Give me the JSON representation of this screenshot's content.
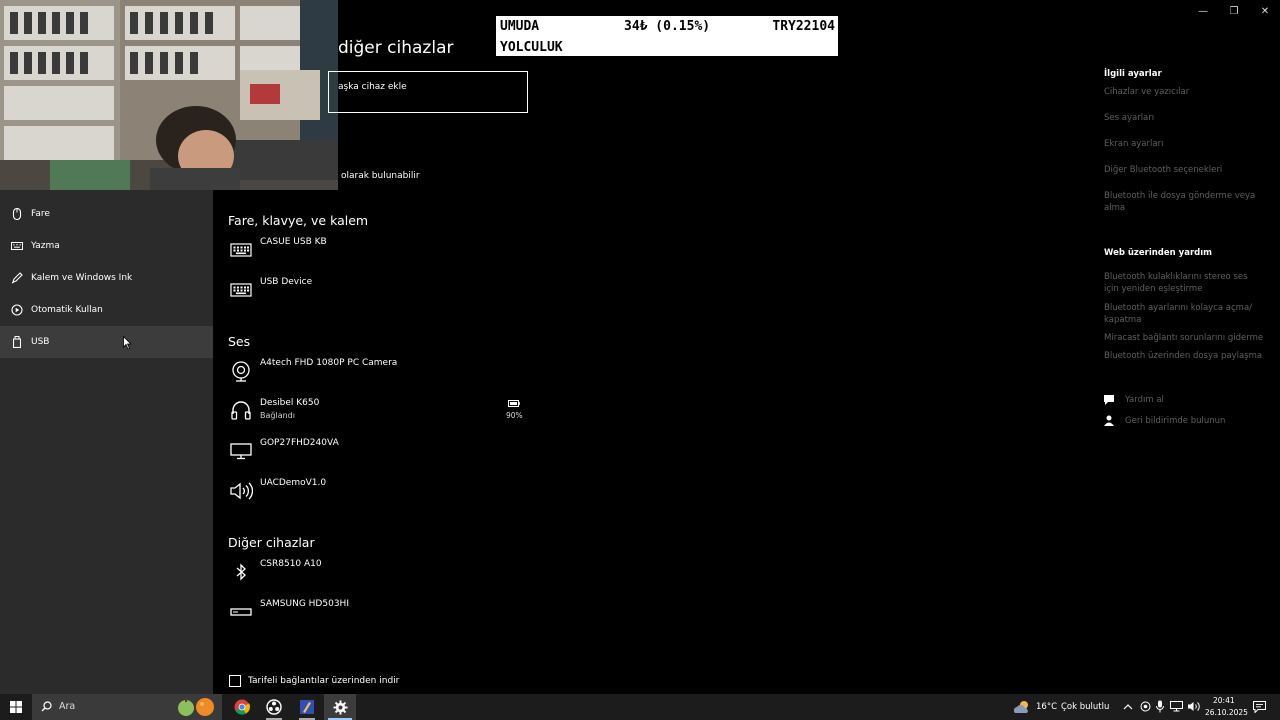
{
  "window": {
    "title_partial": "diğer cihazlar",
    "add_device_partial": "aşka cihaz ekle",
    "discoverable_partial": "olarak bulunabilir"
  },
  "window_controls": {
    "minimize": "—",
    "maximize": "❐",
    "close": "✕"
  },
  "ticker": {
    "name_line1": "UMUDA",
    "name_line2": "YOLCULUK",
    "change": "34₺ (0.15%)",
    "value": "TRY22104"
  },
  "nav": {
    "items": [
      {
        "label": "Fare",
        "icon": "mouse-icon"
      },
      {
        "label": "Yazma",
        "icon": "keyboard-icon"
      },
      {
        "label": "Kalem ve Windows Ink",
        "icon": "pen-icon"
      },
      {
        "label": "Otomatik Kullan",
        "icon": "autoplay-icon"
      },
      {
        "label": "USB",
        "icon": "usb-icon"
      }
    ]
  },
  "sections": {
    "input": {
      "title": "Fare, klavye, ve kalem",
      "devices": [
        {
          "name": "CASUE USB KB",
          "icon": "keyboard-icon"
        },
        {
          "name": "USB Device",
          "icon": "keyboard-icon"
        }
      ]
    },
    "audio": {
      "title": "Ses",
      "devices": [
        {
          "name": "A4tech FHD 1080P PC Camera",
          "icon": "webcam-icon"
        },
        {
          "name": "Desibel K650",
          "status": "Bağlandı",
          "battery": "90%",
          "icon": "headset-icon"
        },
        {
          "name": "GOP27FHD240VA",
          "icon": "monitor-icon"
        },
        {
          "name": "UACDemoV1.0",
          "icon": "speaker-icon"
        }
      ]
    },
    "other": {
      "title": "Diğer cihazlar",
      "devices": [
        {
          "name": "CSR8510 A10",
          "icon": "bluetooth-icon"
        },
        {
          "name": "SAMSUNG HD503HI",
          "icon": "drive-icon"
        }
      ]
    }
  },
  "metered_checkbox": {
    "label": "Tarifeli bağlantılar üzerinden indir",
    "checked": false
  },
  "related": {
    "title": "İlgili ayarlar",
    "links": [
      "Cihazlar ve yazıcılar",
      "Ses ayarları",
      "Ekran ayarları",
      "Diğer Bluetooth seçenekleri",
      "Bluetooth ile dosya gönderme veya alma"
    ]
  },
  "web_help": {
    "title": "Web üzerinden yardım",
    "links": [
      "Bluetooth kulaklıklarını stereo ses için yeniden eşleştirme",
      "Bluetooth ayarlarını kolayca açma/ kapatma",
      "Miracast bağlantı sorunlarını giderme",
      "Bluetooth üzerinden dosya paylaşma"
    ]
  },
  "support": {
    "get_help": "Yardım al",
    "feedback": "Geri bildirimde bulunun"
  },
  "taskbar": {
    "search_placeholder": "Ara",
    "weather_temp": "16°C",
    "weather_desc": "Çok bulutlu",
    "time": "20:41",
    "date": "26.10.2025"
  },
  "colors": {
    "nav_bg": "#2b2b2b",
    "nav_hover": "#3c3c3c",
    "link_muted": "#5f5f5f",
    "taskbar": "#1c1c1c"
  }
}
